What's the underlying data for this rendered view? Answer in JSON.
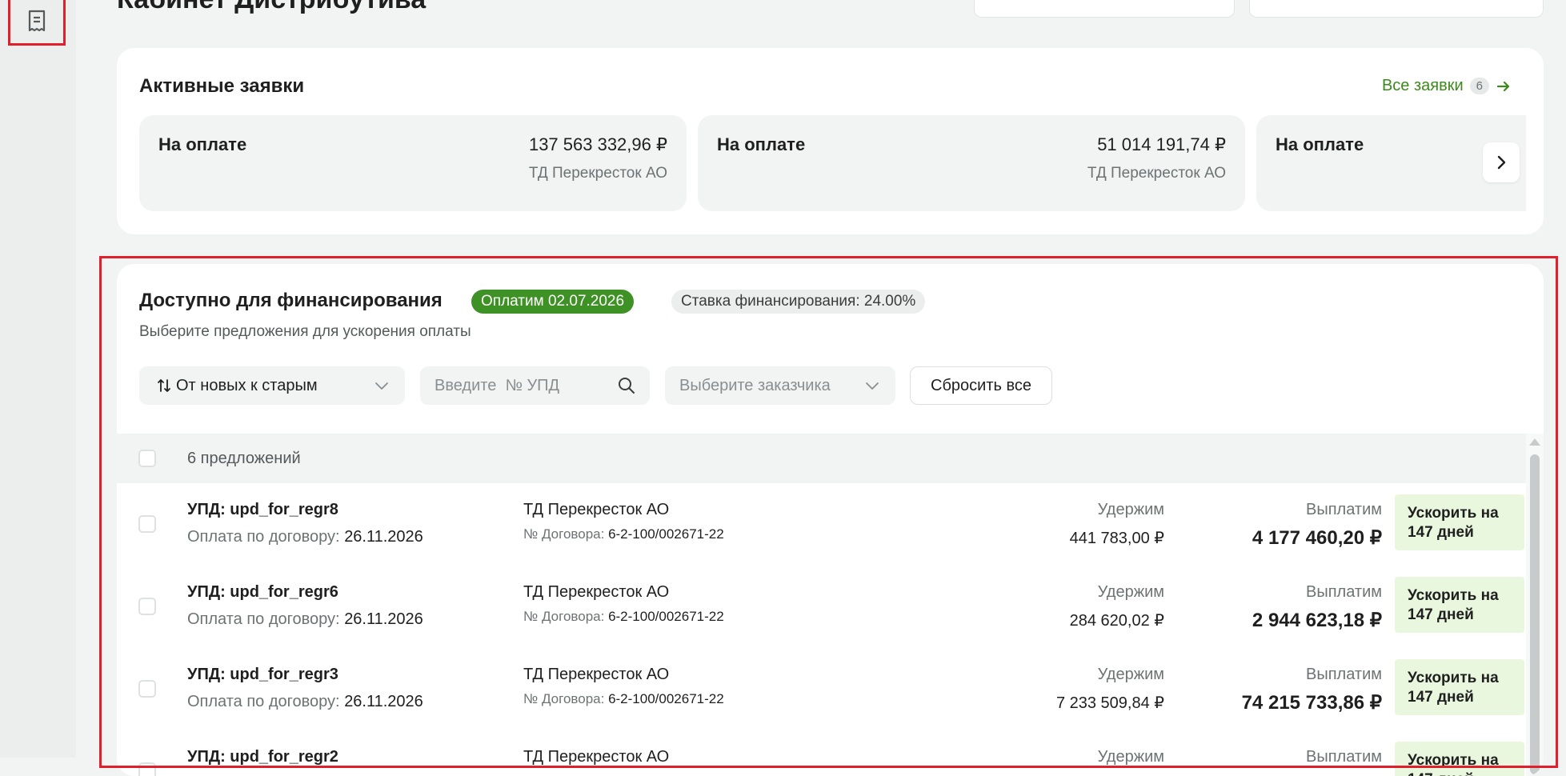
{
  "sidebar": {
    "active_icon": "receipt-icon"
  },
  "header": {
    "title": "Кабинет Дистрибутива"
  },
  "active_applications": {
    "title": "Активные заявки",
    "all_link": "Все заявки",
    "all_count": "6",
    "items": [
      {
        "status": "На оплате",
        "amount": "137 563 332,96 ₽",
        "company": "ТД Перекресток АО"
      },
      {
        "status": "На оплате",
        "amount": "51 014 191,74 ₽",
        "company": "ТД Перекресток АО"
      },
      {
        "status": "На оплате",
        "amount": "",
        "company": ""
      }
    ]
  },
  "financing": {
    "title": "Доступно для финансирования",
    "pay_badge": "Оплатим 02.07.2026",
    "rate_badge": "Ставка финансирования: 24.00%",
    "subtitle": "Выберите предложения для ускорения оплаты",
    "sort_label": "От новых к старым",
    "search_placeholder": "Введите  № УПД",
    "customer_placeholder": "Выберите заказчика",
    "reset_label": "Сбросить все",
    "count_label": "6 предложений",
    "labels": {
      "pay_by_contract": "Оплата по договору:",
      "contract_no": "№ Договора:",
      "hold": "Удержим",
      "payout": "Выплатим",
      "speed_up": "Ускорить на 147 дней"
    },
    "rows": [
      {
        "upd": "УПД: upd_for_regr8",
        "date": "26.11.2026",
        "company": "ТД Перекресток АО",
        "contract": "6-2-100/002671-22",
        "hold": "441 783,00 ₽",
        "payout": "4 177 460,20 ₽"
      },
      {
        "upd": "УПД: upd_for_regr6",
        "date": "26.11.2026",
        "company": "ТД Перекресток АО",
        "contract": "6-2-100/002671-22",
        "hold": "284 620,02 ₽",
        "payout": "2 944 623,18 ₽"
      },
      {
        "upd": "УПД: upd_for_regr3",
        "date": "26.11.2026",
        "company": "ТД Перекресток АО",
        "contract": "6-2-100/002671-22",
        "hold": "7 233 509,84 ₽",
        "payout": "74 215 733,86 ₽"
      },
      {
        "upd": "УПД: upd_for_regr2",
        "date": "",
        "company": "ТД Перекресток АО",
        "contract": "",
        "hold": "",
        "payout": ""
      }
    ]
  },
  "colors": {
    "accent_green": "#3e9225",
    "link_green": "#3c8a1a",
    "highlight_red": "#e01f2b",
    "speed_bg": "#e9f7de"
  }
}
